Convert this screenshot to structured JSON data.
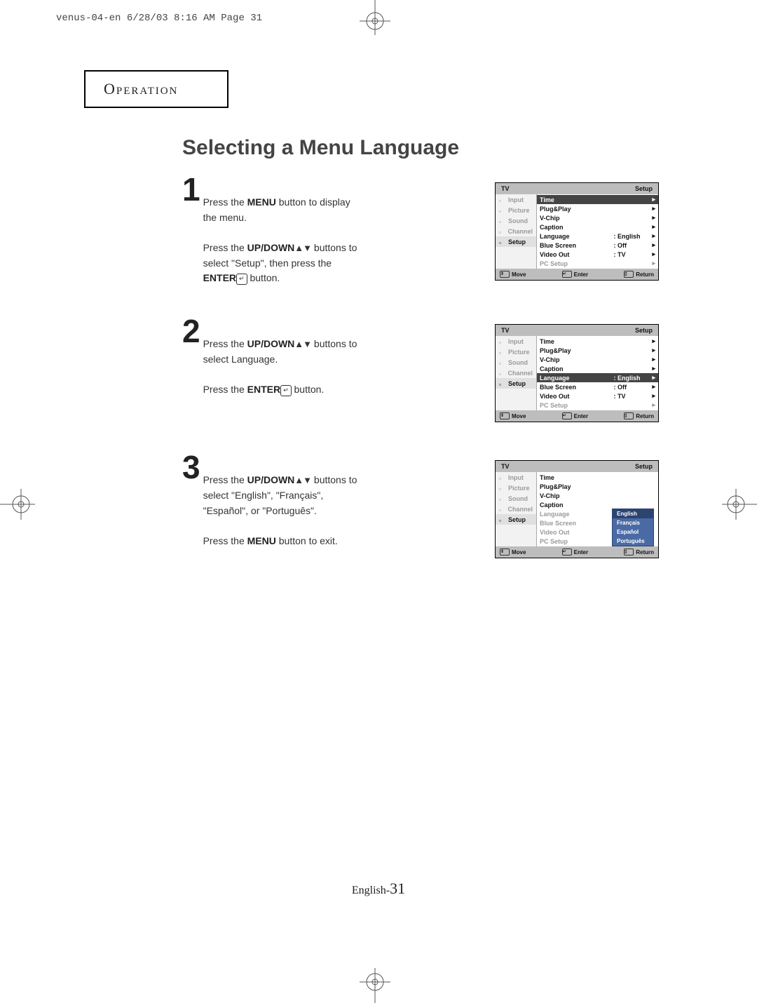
{
  "header_line": "venus-04-en  6/28/03 8:16 AM  Page 31",
  "section_header": "Operation",
  "title": "Selecting a Menu Language",
  "page_number_prefix": "English-",
  "page_number": "31",
  "glyphs": {
    "up": "▲",
    "down": "▼",
    "right": "▸",
    "enter_box": "↵"
  },
  "steps": [
    {
      "number": "1",
      "text_parts": [
        {
          "t": "Press the "
        },
        {
          "t": "MENU",
          "b": true
        },
        {
          "t": " button to display the menu."
        },
        {
          "br": true
        },
        {
          "br": true
        },
        {
          "t": "Press the "
        },
        {
          "t": "UP/DOWN",
          "b": true
        },
        {
          "updown": true
        },
        {
          "t": " buttons to select \"Setup\", then press the "
        },
        {
          "t": "ENTER",
          "b": true
        },
        {
          "enter": true
        },
        {
          "t": " button."
        }
      ],
      "osd": {
        "head_left": "TV",
        "head_right": "Setup",
        "side_active": "Setup",
        "items": [
          {
            "name": "Time",
            "val": "",
            "arrow": true,
            "selected": true
          },
          {
            "name": "Plug&Play",
            "val": "",
            "arrow": true
          },
          {
            "name": "V-Chip",
            "val": "",
            "arrow": true
          },
          {
            "name": "Caption",
            "val": "",
            "arrow": true
          },
          {
            "name": "Language",
            "colon": true,
            "val": "English",
            "arrow": true
          },
          {
            "name": "Blue Screen",
            "colon": true,
            "val": "Off",
            "arrow": true
          },
          {
            "name": "Video Out",
            "colon": true,
            "val": "TV",
            "arrow": true
          },
          {
            "name": "PC Setup",
            "val": "",
            "arrow": true,
            "dim": true
          }
        ],
        "lang_popup": null
      }
    },
    {
      "number": "2",
      "text_parts": [
        {
          "t": "Press the "
        },
        {
          "t": "UP/DOWN",
          "b": true
        },
        {
          "updown": true
        },
        {
          "t": " buttons to select Language."
        },
        {
          "br": true
        },
        {
          "br": true
        },
        {
          "t": "Press the "
        },
        {
          "t": "ENTER",
          "b": true
        },
        {
          "enter": true
        },
        {
          "t": "  button."
        }
      ],
      "osd": {
        "head_left": "TV",
        "head_right": "Setup",
        "side_active": "Setup",
        "items": [
          {
            "name": "Time",
            "val": "",
            "arrow": true
          },
          {
            "name": "Plug&Play",
            "val": "",
            "arrow": true
          },
          {
            "name": "V-Chip",
            "val": "",
            "arrow": true
          },
          {
            "name": "Caption",
            "val": "",
            "arrow": true
          },
          {
            "name": "Language",
            "colon": true,
            "val": "English",
            "arrow": true,
            "selected": true
          },
          {
            "name": "Blue Screen",
            "colon": true,
            "val": "Off",
            "arrow": true
          },
          {
            "name": "Video Out",
            "colon": true,
            "val": "TV",
            "arrow": true
          },
          {
            "name": "PC Setup",
            "val": "",
            "arrow": true,
            "dim": true
          }
        ],
        "lang_popup": null
      }
    },
    {
      "number": "3",
      "text_parts": [
        {
          "t": "Press the "
        },
        {
          "t": "UP/DOWN",
          "b": true
        },
        {
          "updown": true
        },
        {
          "t": " buttons to select \"English\", \"Français\", \"Español\", or \"Português\"."
        },
        {
          "br": true
        },
        {
          "br": true
        },
        {
          "t": "Press the "
        },
        {
          "t": "MENU",
          "b": true
        },
        {
          "t": " button to exit."
        }
      ],
      "osd": {
        "head_left": "TV",
        "head_right": "Setup",
        "side_active": "Setup",
        "items": [
          {
            "name": "Time",
            "val": "",
            "arrow": false
          },
          {
            "name": "Plug&Play",
            "val": "",
            "arrow": false
          },
          {
            "name": "V-Chip",
            "val": "",
            "arrow": false
          },
          {
            "name": "Caption",
            "val": "",
            "arrow": false
          },
          {
            "name": "Language",
            "colon": true,
            "val": "",
            "arrow": false,
            "dim": true
          },
          {
            "name": "Blue Screen",
            "colon": true,
            "val": "",
            "arrow": false,
            "dim": true
          },
          {
            "name": "Video Out",
            "colon": true,
            "val": "",
            "arrow": false,
            "dim": true
          },
          {
            "name": "PC Setup",
            "val": "",
            "arrow": false,
            "dim": true
          }
        ],
        "lang_popup": [
          "English",
          "Français",
          "Español",
          "Português"
        ],
        "lang_popup_hi": 0
      }
    }
  ],
  "osd_common": {
    "side_items": [
      "Input",
      "Picture",
      "Sound",
      "Channel",
      "Setup"
    ],
    "foot": {
      "move": "Move",
      "enter": "Enter",
      "return": "Return"
    }
  }
}
